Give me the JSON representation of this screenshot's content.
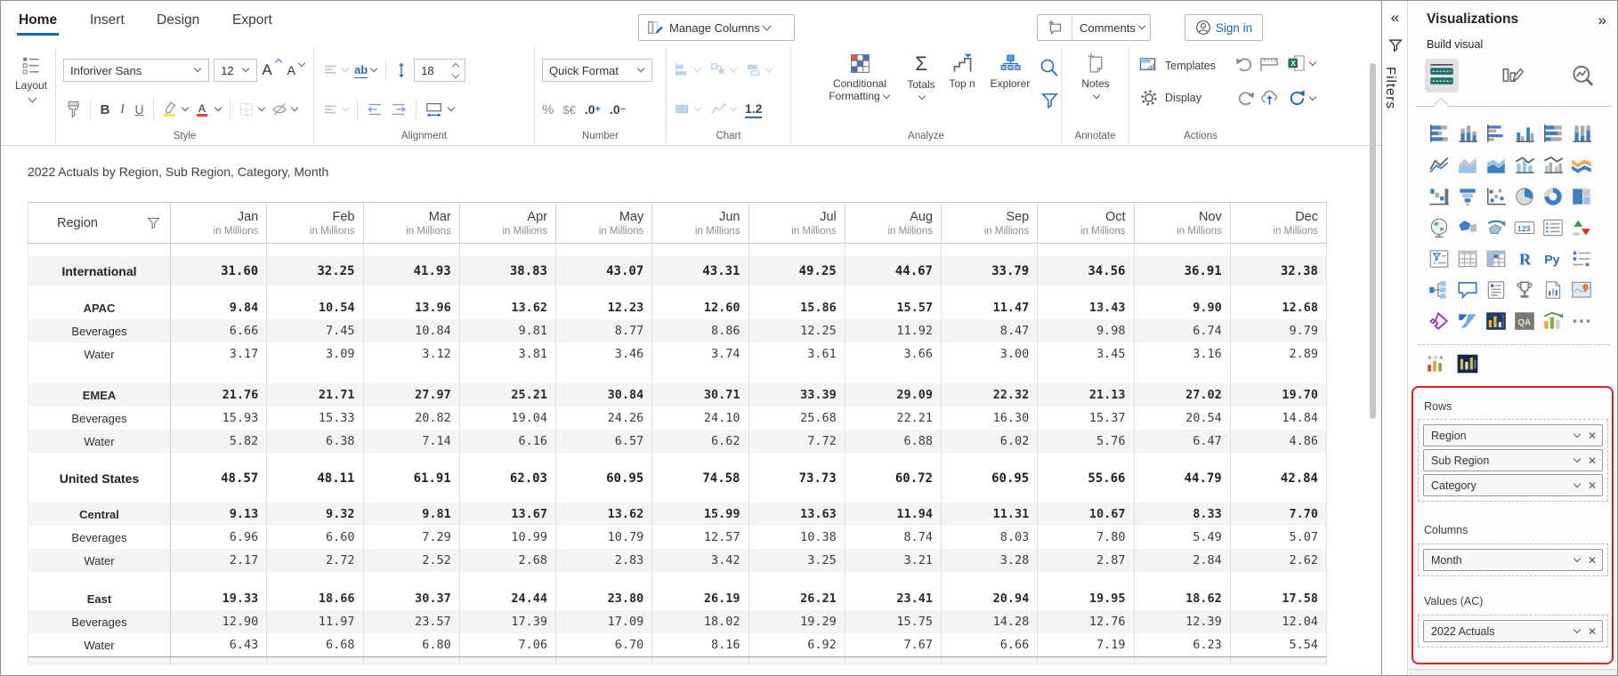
{
  "topbar": {
    "tabs": [
      {
        "label": "Home"
      },
      {
        "label": "Insert"
      },
      {
        "label": "Design"
      },
      {
        "label": "Export"
      }
    ],
    "manage_columns_label": "Manage Columns",
    "comments_label": "Comments",
    "sign_in_label": "Sign in"
  },
  "ribbon": {
    "layout_label": "Layout",
    "font_name": "Inforiver Sans",
    "font_size": "12",
    "font_increase": "A",
    "font_decrease": "A",
    "style_bold": "B",
    "style_italic": "I",
    "style_underline": "U",
    "wrap_label": "ab",
    "row_height": "18",
    "quick_format_label": "Quick Format",
    "percent": "%",
    "currency": "$€",
    "decimal_base": ".0",
    "decimal_plus": "+",
    "decimal_minus": "−",
    "one_decimal": "1.2",
    "conditional_line1": "Conditional",
    "conditional_line2": "Formatting",
    "sigma": "Σ",
    "totals_label": "Totals",
    "top_n_label": "Top n",
    "explorer_label": "Explorer",
    "notes_label": "Notes",
    "templates_label": "Templates",
    "display_label": "Display",
    "sections": {
      "style": "Style",
      "alignment": "Alignment",
      "number": "Number",
      "chart": "Chart",
      "analyze": "Analyze",
      "annotate": "Annotate",
      "actions": "Actions"
    }
  },
  "report": {
    "title": "2022 Actuals by Region, Sub Region, Category, Month"
  },
  "table": {
    "region_header": "Region",
    "value_subtitle": "in Millions",
    "months": [
      "Jan",
      "Feb",
      "Mar",
      "Apr",
      "May",
      "Jun",
      "Jul",
      "Aug",
      "Sep",
      "Oct",
      "Nov",
      "Dec"
    ],
    "rows": [
      {
        "label": "International",
        "level": 1,
        "shade": true,
        "gap": 14,
        "values": [
          "31.60",
          "32.25",
          "41.93",
          "38.83",
          "43.07",
          "43.31",
          "49.25",
          "44.67",
          "33.79",
          "34.56",
          "36.91",
          "32.38"
        ]
      },
      {
        "label": "APAC",
        "level": 2,
        "shade": false,
        "gap": 12,
        "values": [
          "9.84",
          "10.54",
          "13.96",
          "13.62",
          "12.23",
          "12.60",
          "15.86",
          "15.57",
          "11.47",
          "13.43",
          "9.90",
          "12.68"
        ]
      },
      {
        "label": "Beverages",
        "level": 3,
        "shade": true,
        "gap": 0,
        "values": [
          "6.66",
          "7.45",
          "10.84",
          "9.81",
          "8.77",
          "8.86",
          "12.25",
          "11.92",
          "8.47",
          "9.98",
          "6.74",
          "9.79"
        ]
      },
      {
        "label": "Water",
        "level": 3,
        "shade": false,
        "gap": 0,
        "values": [
          "3.17",
          "3.09",
          "3.12",
          "3.81",
          "3.46",
          "3.74",
          "3.61",
          "3.66",
          "3.00",
          "3.45",
          "3.16",
          "2.89"
        ]
      },
      {
        "label": "EMEA",
        "level": 2,
        "shade": true,
        "gap": 20,
        "values": [
          "21.76",
          "21.71",
          "27.97",
          "25.21",
          "30.84",
          "30.71",
          "33.39",
          "29.09",
          "22.32",
          "21.13",
          "27.02",
          "19.70"
        ]
      },
      {
        "label": "Beverages",
        "level": 3,
        "shade": false,
        "gap": 0,
        "values": [
          "15.93",
          "15.33",
          "20.82",
          "19.04",
          "24.26",
          "24.10",
          "25.68",
          "22.21",
          "16.30",
          "15.37",
          "20.54",
          "14.84"
        ]
      },
      {
        "label": "Water",
        "level": 3,
        "shade": true,
        "gap": 0,
        "values": [
          "5.82",
          "6.38",
          "7.14",
          "6.16",
          "6.57",
          "6.62",
          "7.72",
          "6.88",
          "6.02",
          "5.76",
          "6.47",
          "4.86"
        ]
      },
      {
        "label": "United States",
        "level": 1,
        "shade": false,
        "gap": 12,
        "values": [
          "48.57",
          "48.11",
          "61.91",
          "62.03",
          "60.95",
          "74.58",
          "73.73",
          "60.72",
          "60.95",
          "55.66",
          "44.79",
          "42.84"
        ]
      },
      {
        "label": "Central",
        "level": 2,
        "shade": true,
        "gap": 11,
        "values": [
          "9.13",
          "9.32",
          "9.81",
          "13.67",
          "13.62",
          "15.99",
          "13.63",
          "11.94",
          "11.31",
          "10.67",
          "8.33",
          "7.70"
        ]
      },
      {
        "label": "Beverages",
        "level": 3,
        "shade": false,
        "gap": 0,
        "values": [
          "6.96",
          "6.60",
          "7.29",
          "10.99",
          "10.79",
          "12.57",
          "10.38",
          "8.74",
          "8.03",
          "7.80",
          "5.49",
          "5.07"
        ]
      },
      {
        "label": "Water",
        "level": 3,
        "shade": true,
        "gap": 0,
        "values": [
          "2.17",
          "2.72",
          "2.52",
          "2.68",
          "2.83",
          "3.42",
          "3.25",
          "3.21",
          "3.28",
          "2.87",
          "2.84",
          "2.62"
        ]
      },
      {
        "label": "East",
        "level": 2,
        "shade": false,
        "gap": 17,
        "values": [
          "19.33",
          "18.66",
          "30.37",
          "24.44",
          "23.80",
          "26.19",
          "26.21",
          "23.41",
          "20.94",
          "19.95",
          "18.62",
          "17.58"
        ]
      },
      {
        "label": "Beverages",
        "level": 3,
        "shade": true,
        "gap": 0,
        "values": [
          "12.90",
          "11.97",
          "23.57",
          "17.39",
          "17.09",
          "18.02",
          "19.29",
          "15.75",
          "14.28",
          "12.76",
          "12.39",
          "12.04"
        ]
      },
      {
        "label": "Water",
        "level": 3,
        "shade": false,
        "gap": 0,
        "values": [
          "6.43",
          "6.68",
          "6.80",
          "7.06",
          "6.70",
          "8.16",
          "6.92",
          "7.67",
          "6.66",
          "7.19",
          "6.23",
          "5.54"
        ]
      }
    ]
  },
  "filters_pane": {
    "label": "Filters",
    "collapse_icon": "«"
  },
  "viz_pane": {
    "title": "Visualizations",
    "expand_icon": "»",
    "build_visual_label": "Build visual",
    "gallery": [
      "stacked-bar-chart",
      "stacked-column-chart",
      "clustered-bar-chart",
      "clustered-column-chart",
      "100-stacked-bar-chart",
      "100-stacked-column-chart",
      "line-chart",
      "area-chart",
      "stacked-area-chart",
      "line-and-stacked-column-chart",
      "line-and-clustered-column-chart",
      "ribbon-chart",
      "waterfall-chart",
      "funnel-chart",
      "scatter-chart",
      "pie-chart",
      "donut-chart",
      "treemap",
      "map",
      "filled-map",
      "azure-map",
      "card",
      "multi-row-card",
      "kpi",
      "slicer",
      "table",
      "matrix",
      "r-script-visual",
      "python-visual",
      "button-slicer",
      "decomposition-tree",
      "qa-visual",
      "smart-narrative",
      "metrics",
      "paginated-report",
      "arcgis-map",
      "power-apps",
      "power-automate",
      "custom-visual-grid",
      "custom-visual-qa",
      "custom-visual-chart",
      "more-options"
    ],
    "custom_visuals": [
      "custom-inforiver-charts",
      "custom-inforiver-dark"
    ],
    "wells": {
      "rows_label": "Rows",
      "rows": [
        "Region",
        "Sub Region",
        "Category"
      ],
      "columns_label": "Columns",
      "columns": [
        "Month"
      ],
      "values_label": "Values (AC)",
      "values": [
        "2022 Actuals"
      ]
    }
  },
  "colors": {
    "accent_blue": "#1168bd",
    "annotation_red": "#e31c23",
    "visual_teal": "#1a6f68"
  }
}
